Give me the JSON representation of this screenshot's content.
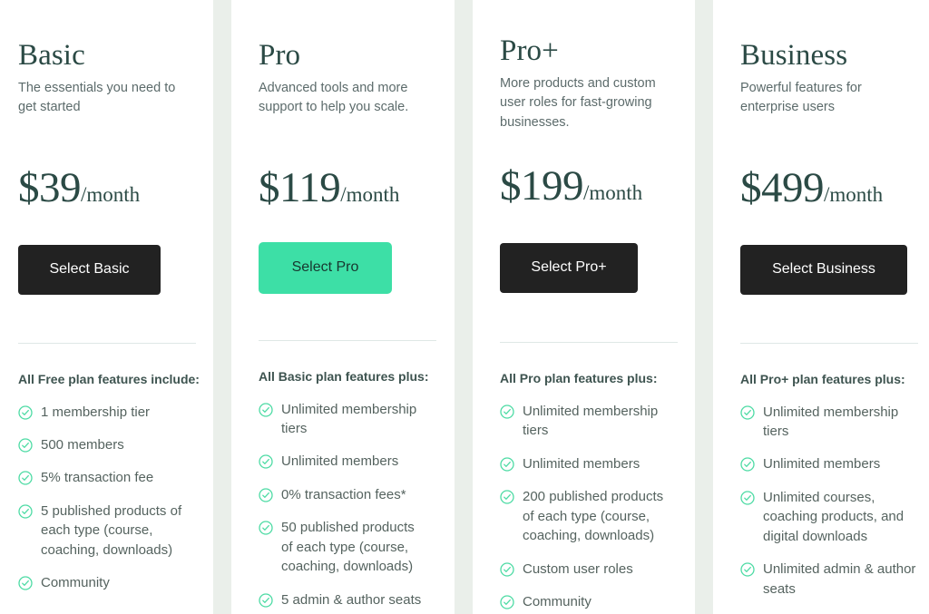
{
  "theme": {
    "page_background": "#ffffff",
    "gutter_color": "#eaefea",
    "heading_color": "#2b4a45",
    "body_text_color": "#55635f",
    "description_color": "#5c6b6b",
    "divider_color": "#dfe8e6",
    "check_icon_color": "#4ddba4",
    "dark_button_bg": "#222222",
    "dark_button_text": "#ffffff",
    "accent_button_bg": "#3ddfa6",
    "accent_button_text": "#18372f"
  },
  "plans": [
    {
      "name": "Basic",
      "description": "The essentials you need to get started",
      "price_amount": "$39",
      "price_period": "/month",
      "cta_label": "Select Basic",
      "cta_style": "dark",
      "features_heading": "All Free plan features include:",
      "features": [
        "1 membership tier",
        "500 members",
        "5% transaction fee",
        "5 published products of each type (course, coaching, downloads)",
        "Community"
      ]
    },
    {
      "name": "Pro",
      "description": "Advanced tools and more support to help you scale.",
      "price_amount": "$119",
      "price_period": "/month",
      "cta_label": "Select Pro",
      "cta_style": "accent",
      "features_heading": "All Basic plan features plus:",
      "features": [
        "Unlimited membership tiers",
        "Unlimited members",
        "0% transaction fees*",
        "50 published products of each type (course, coaching, downloads)",
        "5 admin & author seats"
      ]
    },
    {
      "name": "Pro+",
      "description": "More products and custom user roles for fast-growing businesses.",
      "price_amount": "$199",
      "price_period": "/month",
      "cta_label": "Select Pro+",
      "cta_style": "dark",
      "features_heading": "All Pro plan features plus:",
      "features": [
        "Unlimited membership tiers",
        "Unlimited members",
        "200 published products of each type (course, coaching, downloads)",
        "Custom user roles",
        "Community"
      ]
    },
    {
      "name": "Business",
      "description": "Powerful features for enterprise users",
      "price_amount": "$499",
      "price_period": "/month",
      "cta_label": "Select Business",
      "cta_style": "dark",
      "features_heading": "All Pro+ plan features plus:",
      "features": [
        "Unlimited membership tiers",
        "Unlimited members",
        "Unlimited courses, coaching products, and digital downloads",
        "Unlimited admin & author seats"
      ]
    }
  ]
}
